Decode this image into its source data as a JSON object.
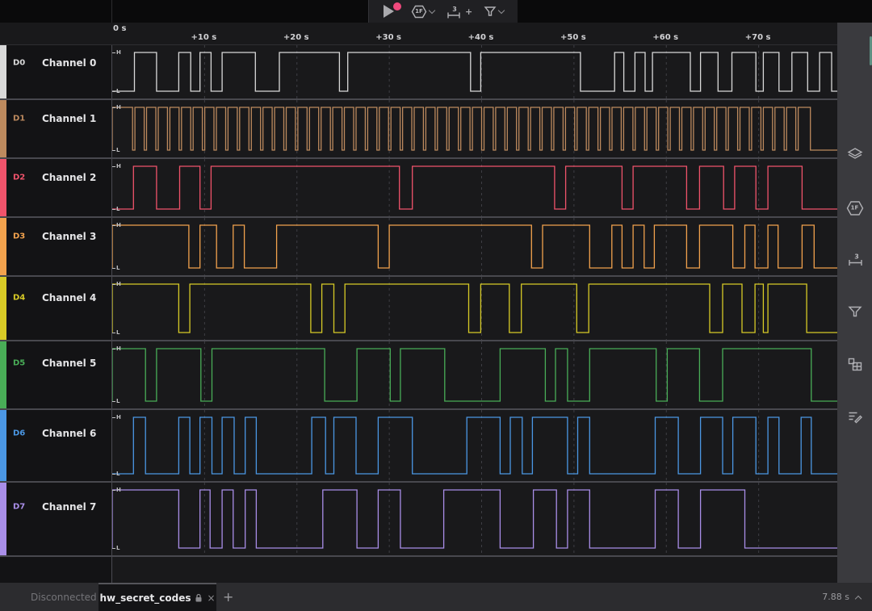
{
  "toolbar": {
    "radix_label": "1F",
    "measure_badge": "3",
    "measure_add": "+"
  },
  "ruler": {
    "origin_label": "0 s",
    "tick_seconds": [
      10,
      20,
      30,
      40,
      50,
      60,
      70
    ],
    "tick_labels": [
      "+10 s",
      "+20 s",
      "+30 s",
      "+40 s",
      "+50 s",
      "+60 s",
      "+70 s"
    ]
  },
  "timebase": {
    "seconds_total": 78.6
  },
  "wave_labels": {
    "high": "H",
    "low": "L"
  },
  "channels": [
    {
      "id": "D0",
      "name": "Channel 0",
      "color": "#d9d9d9",
      "initial": "L",
      "transitions": [
        2.4,
        4.8,
        7.2,
        8.5,
        9.5,
        10.7,
        11.9,
        15.5,
        18.1,
        24.6,
        25.5,
        38.8,
        39.9,
        50.7,
        54.4,
        55.4,
        56.6,
        57.7,
        58.5,
        62.6,
        63.7,
        65.6,
        67.1,
        69.7,
        70.5,
        72.2,
        73.6,
        75.3,
        76.6,
        77.9
      ]
    },
    {
      "id": "D1",
      "name": "Channel 1",
      "color": "#bd8a5e",
      "initial": "H",
      "clock": {
        "first_fall": 2.2,
        "period": 1.26,
        "low_width": 0.26,
        "pulse_count": 58,
        "final_fall": 75.6
      }
    },
    {
      "id": "D2",
      "name": "Channel 2",
      "color": "#f0536b",
      "initial": "L",
      "transitions": [
        2.3,
        4.8,
        7.3,
        9.5,
        10.7,
        31.1,
        32.5,
        47.9,
        49.1,
        55.2,
        56.4,
        62.2,
        63.6,
        66.2,
        67.4,
        69.7,
        71.0,
        74.7
      ]
    },
    {
      "id": "D3",
      "name": "Channel 3",
      "color": "#f2a24d",
      "initial": "H",
      "transitions": [
        8.3,
        9.5,
        11.3,
        13.1,
        14.3,
        17.8,
        28.8,
        30.0,
        45.4,
        46.6,
        51.7,
        54.1,
        55.2,
        56.4,
        57.6,
        58.7,
        62.2,
        63.6,
        67.2,
        68.5,
        69.6,
        71.0,
        72.1,
        74.7,
        76.0
      ]
    },
    {
      "id": "D4",
      "name": "Channel 4",
      "color": "#d8cb26",
      "initial": "H",
      "transitions": [
        7.2,
        8.4,
        21.5,
        22.7,
        24.0,
        25.2,
        38.6,
        39.9,
        43.0,
        44.3,
        50.3,
        51.6,
        64.7,
        66.1,
        68.2,
        69.6,
        70.5,
        71.0,
        75.2
      ]
    },
    {
      "id": "D5",
      "name": "Channel 5",
      "color": "#49ad57",
      "initial": "H",
      "transitions": [
        3.6,
        4.8,
        9.6,
        10.8,
        23.0,
        26.5,
        30.1,
        31.2,
        36.0,
        42.0,
        46.9,
        48.0,
        49.3,
        51.7,
        58.9,
        60.1,
        63.6,
        66.1,
        75.7
      ]
    },
    {
      "id": "D6",
      "name": "Channel 6",
      "color": "#4b97e4",
      "initial": "L",
      "transitions": [
        2.3,
        3.6,
        7.2,
        8.4,
        9.5,
        10.8,
        11.9,
        13.2,
        14.4,
        15.6,
        21.6,
        23.1,
        24.0,
        26.4,
        28.8,
        32.5,
        38.4,
        42.0,
        43.1,
        44.4,
        45.5,
        49.3,
        50.4,
        51.7,
        58.8,
        61.3,
        63.7,
        66.1,
        67.2,
        69.7,
        71.0,
        72.2,
        74.6,
        75.7
      ]
    },
    {
      "id": "D7",
      "name": "Channel 7",
      "color": "#a98ee8",
      "initial": "H",
      "transitions": [
        7.2,
        9.5,
        10.6,
        11.9,
        13.1,
        14.4,
        15.6,
        22.8,
        26.5,
        28.8,
        31.2,
        35.9,
        42.0,
        45.6,
        48.1,
        49.3,
        51.7,
        58.8,
        61.3,
        63.7,
        68.5
      ]
    }
  ],
  "sidebar": {
    "radix_label": "1F",
    "measure_badge": "3",
    "icons": [
      "layers",
      "radix-hex",
      "measurements",
      "filter",
      "blocks",
      "annotations"
    ]
  },
  "statusbar": {
    "device_status": "Disconnected",
    "tab_title": "hw_secret_codes",
    "close_tab": "×",
    "add_tab": "+",
    "capture_time": "7.88 s"
  },
  "colors": {
    "record_accent": "#f0497d",
    "scrollbar_teal": "#5d8f81",
    "grid_line": "#3e3e44",
    "row_divider": "#48484e"
  }
}
